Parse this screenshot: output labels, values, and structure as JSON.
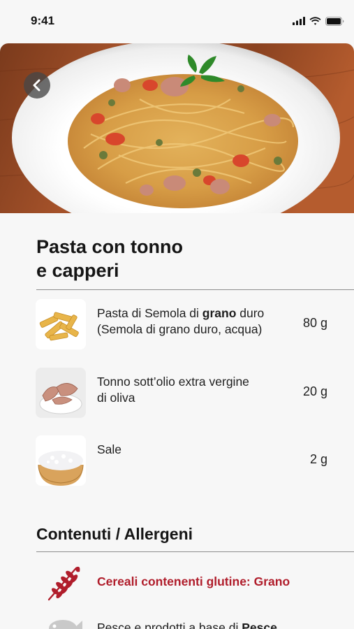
{
  "status_bar": {
    "time": "9:41",
    "icons": [
      "signal-icon",
      "wifi-icon",
      "battery-icon"
    ]
  },
  "recipe": {
    "title_line1": "Pasta con tonno",
    "title_line2": "e capperi"
  },
  "ingredients": [
    {
      "name_pre": "Pasta di Semola di ",
      "name_bold": "grano",
      "name_post": " duro",
      "sub": "(Semola di grano duro, acqua)",
      "quantity": "80 g",
      "image": "penne-pasta"
    },
    {
      "name": "Tonno sott’olio extra vergine",
      "sub": "di oliva",
      "quantity": "20 g",
      "image": "tuna-in-oil"
    },
    {
      "name": "Sale",
      "quantity": "2 g",
      "image": "salt-bowl"
    }
  ],
  "allergens_section": {
    "title": "Contenuti / Allergeni",
    "items": [
      {
        "label": "Cereali contenenti glutine: Grano",
        "icon": "wheat-icon",
        "color": "#b01d2b"
      },
      {
        "label_pre": "Pesce e prodotti a base di ",
        "label_bold": "Pesce",
        "icon": "fish-icon"
      }
    ]
  },
  "colors": {
    "background": "#f7f7f7",
    "accent_red": "#b01d2b",
    "divider": "#8d8d8d"
  }
}
